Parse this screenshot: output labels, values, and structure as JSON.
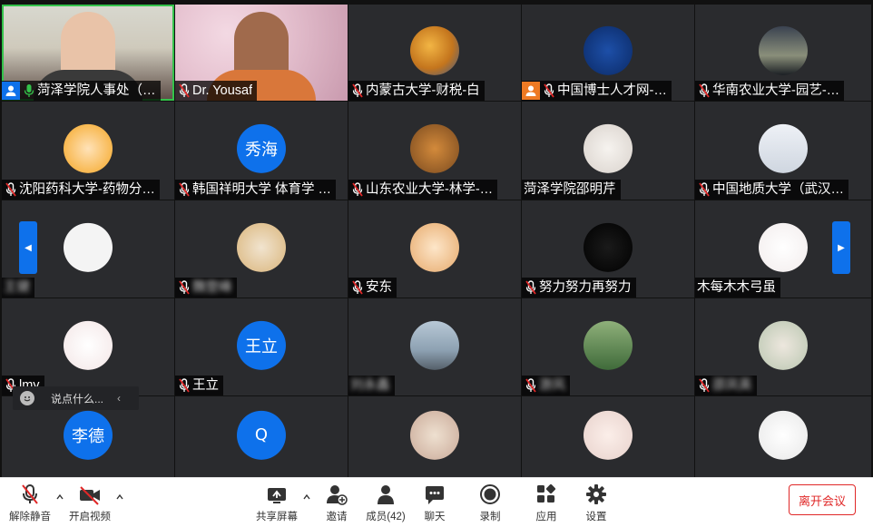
{
  "tiles": [
    {
      "name": "菏泽学院人事处（…",
      "host": "blue",
      "mic": "on",
      "video": "cam1",
      "active": true
    },
    {
      "name": "Dr. Yousaf",
      "mic": "muted",
      "video": "cam2"
    },
    {
      "name": "内蒙古大学-财税-白",
      "mic": "muted",
      "avatar": "autumn-tree"
    },
    {
      "name": "中国博士人才网-…",
      "host": "orange",
      "mic": "muted",
      "avatar": "doctor-logo"
    },
    {
      "name": "华南农业大学-园艺-…",
      "mic": "muted",
      "avatar": "night-landscape"
    },
    {
      "name": "沈阳药科大学-药物分…",
      "mic": "muted",
      "avatar": "cartoon-boy"
    },
    {
      "name": "韩国祥明大学 体育学 …",
      "mic": "muted",
      "avatar_text": "秀海"
    },
    {
      "name": "山东农业大学-林学-…",
      "mic": "muted",
      "avatar": "cartoon-bear"
    },
    {
      "name": "菏泽学院邵明芹",
      "mic": "none",
      "avatar": "princess"
    },
    {
      "name": "中国地质大学（武汉…",
      "mic": "muted",
      "avatar": "calligraphy-card"
    },
    {
      "name": "王健",
      "mic": "none",
      "blur": true,
      "avatar": "physics-diagram"
    },
    {
      "name": "魏登峰",
      "mic": "muted",
      "blur": true,
      "avatar": "tiger"
    },
    {
      "name": "安东",
      "mic": "muted",
      "avatar": "cartoon-kid"
    },
    {
      "name": "努力努力再努力",
      "mic": "muted",
      "avatar": "red-logo"
    },
    {
      "name": "木每木木弓虽",
      "mic": "none",
      "avatar": "girl-lantern"
    },
    {
      "name": "lmy",
      "mic": "muted",
      "avatar": "girl-cartoon"
    },
    {
      "name": "王立",
      "mic": "muted",
      "avatar_text": "王立"
    },
    {
      "name": "刘永鑫",
      "mic": "none",
      "blur": true,
      "avatar": "city-building"
    },
    {
      "name": "游风",
      "mic": "muted",
      "blur": true,
      "avatar": "person-photo"
    },
    {
      "name": "邵凤英",
      "mic": "muted",
      "blur": true,
      "avatar": "flowers"
    },
    {
      "name": "",
      "mic": "none",
      "avatar_text": "李德"
    },
    {
      "name": "",
      "mic": "none",
      "avatar_text": "Q"
    },
    {
      "name": "",
      "mic": "none",
      "avatar": "room-photo"
    },
    {
      "name": "",
      "mic": "none",
      "avatar": "cartoon-girl2"
    },
    {
      "name": "",
      "mic": "none",
      "avatar": "calligraphy-zhang"
    }
  ],
  "chat": {
    "placeholder": "说点什么..."
  },
  "toolbar": {
    "mute_label": "解除静音",
    "video_label": "开启视频",
    "share_label": "共享屏幕",
    "invite_label": "邀请",
    "members_label": "成员(42)",
    "chat_label": "聊天",
    "record_label": "录制",
    "apps_label": "应用",
    "settings_label": "设置",
    "leave_label": "离开会议"
  },
  "colors": {
    "accent": "#0e71eb",
    "leave": "#e02828",
    "muted_mic": "#e02828",
    "host_orange": "#ee7a23",
    "active_outline": "#33c24a"
  }
}
